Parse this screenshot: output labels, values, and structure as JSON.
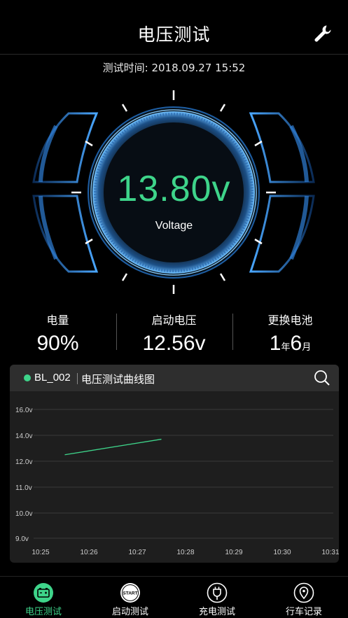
{
  "header": {
    "title": "电压测试",
    "settings_icon": "wrench-icon"
  },
  "test_time": {
    "label": "测试时间: 2018.09.27  15:52"
  },
  "gauge": {
    "value": "13.80v",
    "label": "Voltage",
    "accent": "#3ed48a",
    "ring_color": "#3a8fe0"
  },
  "stats": [
    {
      "label": "电量",
      "value": "90%"
    },
    {
      "label": "启动电压",
      "value": "12.56v"
    },
    {
      "label": "更换电池",
      "num1": "1",
      "unit1": "年",
      "num2": "6",
      "unit2": "月"
    }
  ],
  "chart_card": {
    "device": "BL_002",
    "title": "电压测试曲线图",
    "search_icon": "search-icon",
    "status_color": "#3ed48a"
  },
  "chart_data": {
    "type": "line",
    "x": [
      "10:25",
      "10:26",
      "10:27",
      "10:28",
      "10:29",
      "10:30",
      "10:31"
    ],
    "yticks": [
      "16.0v",
      "14.0v",
      "12.0v",
      "11.0v",
      "10.0v",
      "9.0v"
    ],
    "series": [
      {
        "points": [
          [
            "10:25:30",
            12.5
          ],
          [
            "10:27:30",
            13.7
          ]
        ],
        "color": "#3ed48a"
      }
    ],
    "grid": true
  },
  "nav": [
    {
      "label": "电压测试",
      "icon": "battery-icon",
      "active": true
    },
    {
      "label": "启动测试",
      "icon": "start-icon",
      "active": false
    },
    {
      "label": "充电测试",
      "icon": "plug-icon",
      "active": false
    },
    {
      "label": "行车记录",
      "icon": "location-icon",
      "active": false
    }
  ],
  "nav_start_text": "START"
}
